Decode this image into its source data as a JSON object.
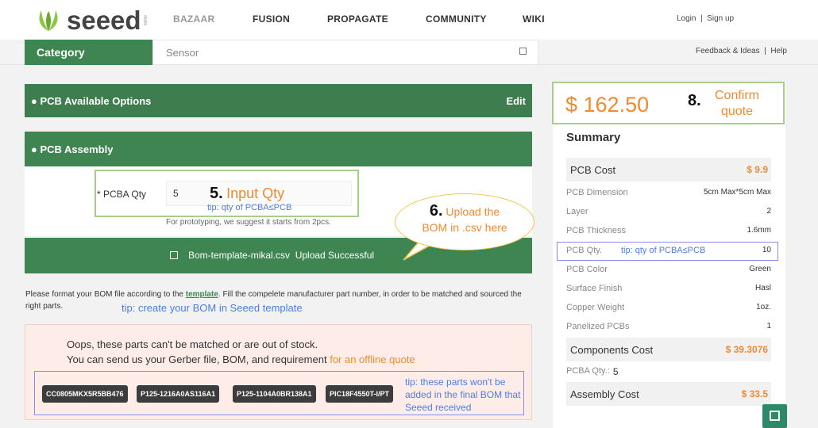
{
  "header": {
    "logo": {
      "word": "seeed",
      "sub": "studio"
    },
    "nav": [
      "BAZAAR",
      "FUSION",
      "PROPAGATE",
      "COMMUNITY",
      "WIKI"
    ],
    "auth": "Login  |  Sign up"
  },
  "category_bar": {
    "category_label": "Category",
    "input_value": "Sensor",
    "feedback": "Feedback & Ideas  |  Help"
  },
  "left": {
    "options_bar": {
      "label": "● PCB Available Options",
      "edit": "Edit"
    },
    "assembly_bar": {
      "label": "● PCB Assembly"
    },
    "qty": {
      "label": "* PCBA Qty",
      "value": "5",
      "ann_num": "5.",
      "ann_text": "Input Qty",
      "tip": "tip: qty of PCBA≤PCB",
      "note": "For prototyping, we suggest it starts from 2pcs."
    },
    "upload": {
      "file": "Bom-template-mikal.csv  Upload Successful"
    },
    "bubble": {
      "num": "6.",
      "line1": "Upload the",
      "line2": "BOM in .csv here"
    },
    "format": {
      "pre": "Please format your BOM file according to the ",
      "link": "template",
      "post": ". Fill the compelete manufacturer part number, in order to be matched and sourced the right parts.",
      "tip": "tip: create your BOM in Seeed template"
    },
    "oops": {
      "line1": "Oops, these parts can't be matched or are out of stock.",
      "line2_pre": "You can send us your Gerber file, BOM, and requirement ",
      "line2_link": "for an offline quote",
      "parts": [
        "CC0805MKX5R5BB476",
        "P125-1216A0AS116A1",
        "P125-1104A0BR138A1",
        "PIC18F4550T-I/PT"
      ],
      "tip": "tip: these parts won't be added in the final BOM that Seeed received"
    }
  },
  "right": {
    "price": "$ 162.50",
    "ann_num": "8.",
    "confirm": "Confirm quote",
    "summary_title": "Summary",
    "pcb_cost": {
      "label": "PCB Cost",
      "value": "$ 9.9"
    },
    "rows": [
      {
        "label": "PCB Dimension",
        "value": "5cm Max*5cm Max"
      },
      {
        "label": "Layer",
        "value": "2"
      },
      {
        "label": "PCB Thickness",
        "value": "1.6mm"
      },
      {
        "label": "PCB Qty.",
        "value": "10"
      },
      {
        "label": "PCB Color",
        "value": "Green"
      },
      {
        "label": "Surface Finish",
        "value": "Hasl"
      },
      {
        "label": "Copper Weight",
        "value": "1oz."
      },
      {
        "label": "Panelized PCBs",
        "value": "1"
      }
    ],
    "pcb_qty_tip": "tip: qty of PCBA≤PCB",
    "components_cost": {
      "label": "Components Cost",
      "value": "$ 39.3076"
    },
    "pcba_qty": {
      "label": "PCBA Qty.:",
      "value": "5"
    },
    "assembly_cost": {
      "label": "Assembly Cost",
      "value": "$ 33.5"
    }
  },
  "colors": {
    "green": "#3e8552",
    "orange": "#f08a30",
    "tip_blue": "#4d7de0"
  }
}
